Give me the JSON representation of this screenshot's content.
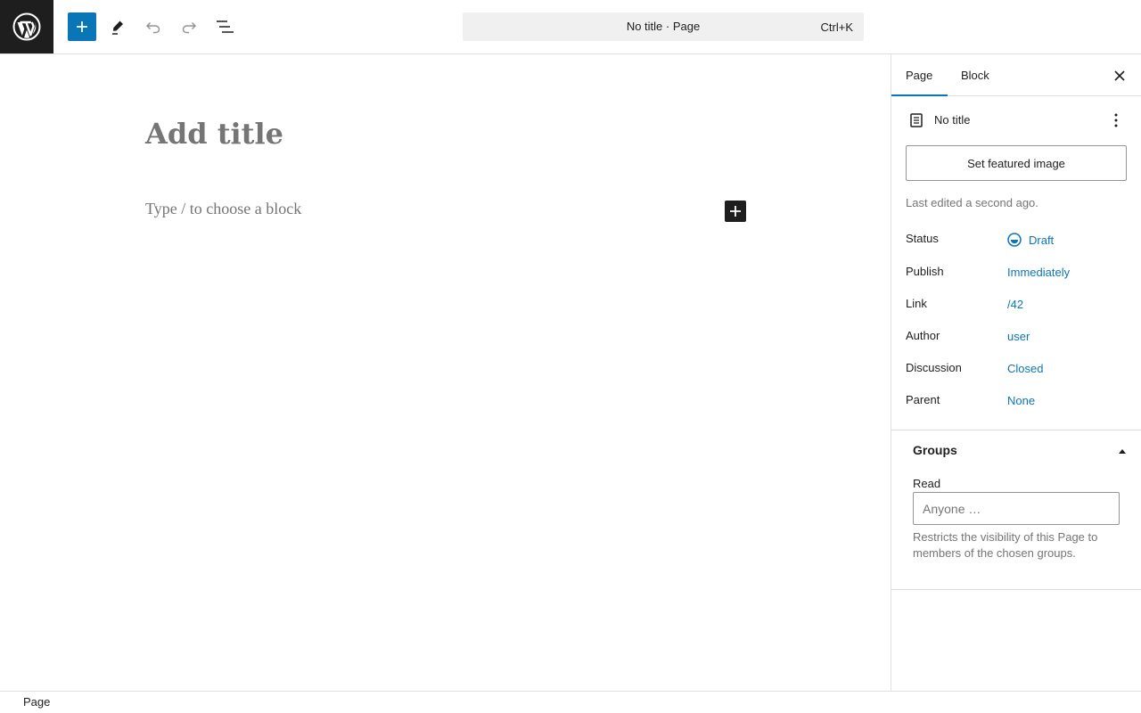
{
  "toolbar": {
    "logo_icon": "wordpress-logo-icon",
    "add_block_icon": "plus-icon",
    "tools_icon": "pencil-icon",
    "undo_icon": "undo-icon",
    "redo_icon": "redo-icon",
    "outline_icon": "list-view-icon",
    "accent_color": "#0a76b8"
  },
  "command_bar": {
    "title": "No title · Page",
    "shortcut": "Ctrl+K"
  },
  "editor": {
    "title_placeholder": "Add title",
    "block_placeholder": "Type / to choose a block",
    "inserter_icon": "plus-icon"
  },
  "sidebar": {
    "tabs": [
      {
        "label": "Page",
        "active": true
      },
      {
        "label": "Block",
        "active": false
      }
    ],
    "close_icon": "close-icon",
    "document": {
      "icon": "page-icon",
      "title": "No title",
      "more_icon": "more-vertical-icon"
    },
    "featured_image_label": "Set featured image",
    "last_edited": "Last edited a second ago.",
    "meta": [
      {
        "label": "Status",
        "value": "Draft",
        "icon": "draft-status-icon"
      },
      {
        "label": "Publish",
        "value": "Immediately"
      },
      {
        "label": "Link",
        "value": "/42"
      },
      {
        "label": "Author",
        "value": "user"
      },
      {
        "label": "Discussion",
        "value": "Closed"
      },
      {
        "label": "Parent",
        "value": "None"
      }
    ],
    "groups": {
      "heading": "Groups",
      "toggle_icon": "chevron-up-icon",
      "read_label": "Read",
      "read_placeholder": "Anyone …",
      "help_text": "Restricts the visibility of this Page to members of the chosen groups."
    }
  },
  "footer": {
    "breadcrumb": "Page"
  }
}
